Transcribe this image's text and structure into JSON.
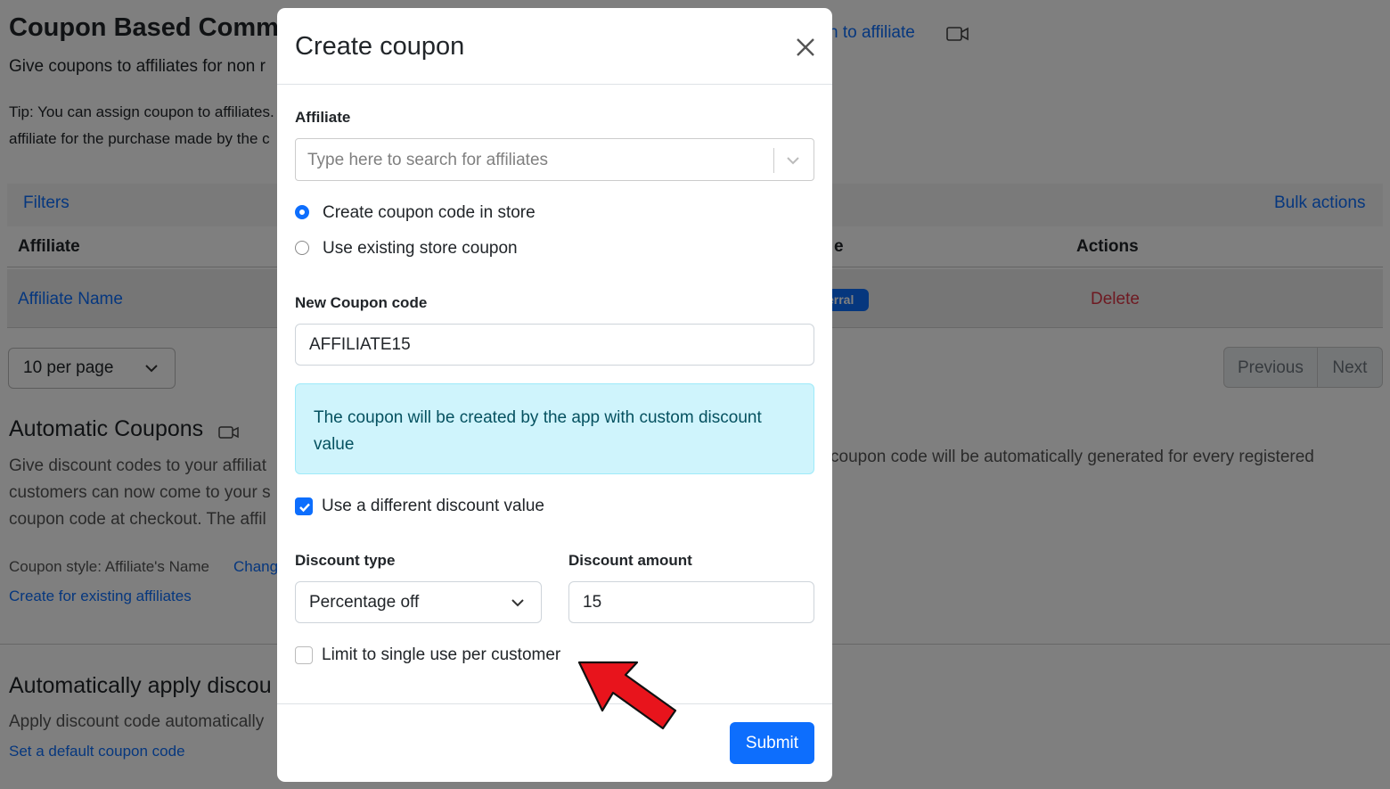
{
  "background": {
    "page_title": "Coupon Based Commi",
    "page_subtitle": "Give coupons to affiliates for non r",
    "assign_link": "n to affiliate",
    "tip_line1": "Tip: You can assign coupon to affiliates.",
    "tip_line2": "affiliate for the purchase made by the c",
    "filters": "Filters",
    "bulk_actions": "Bulk actions",
    "table_headers": {
      "affiliate": "Affiliate",
      "type_partial": "e",
      "actions": "Actions"
    },
    "row": {
      "affiliate_name": "Affiliate Name",
      "badge": "erral",
      "delete": "Delete"
    },
    "per_page": "10 per page",
    "pager": {
      "previous": "Previous",
      "next": "Next"
    },
    "automatic_coupons": {
      "title": "Automatic Coupons",
      "line1": "Give discount codes to your affiliat",
      "line2": "customers can now come to your s",
      "line3": "coupon code at checkout. The affil",
      "right_text": "coupon code will be automatically generated for every registered",
      "coupon_style": "Coupon style: Affiliate's Name",
      "change": "Chang",
      "create_existing": "Create for existing affiliates"
    },
    "auto_apply": {
      "title": "Automatically apply discou",
      "line1": "Apply discount code automatically",
      "set_default": "Set a default coupon code"
    }
  },
  "modal": {
    "title": "Create coupon",
    "affiliate_label": "Affiliate",
    "affiliate_placeholder": "Type here to search for affiliates",
    "radio_create": "Create coupon code in store",
    "radio_existing": "Use existing store coupon",
    "coupon_code_label": "New Coupon code",
    "coupon_code_value": "AFFILIATE15",
    "alert_text": "The coupon will be created by the app with custom discount value",
    "different_discount_label": "Use a different discount value",
    "discount_type_label": "Discount type",
    "discount_type_value": "Percentage off",
    "discount_amount_label": "Discount amount",
    "discount_amount_value": "15",
    "limit_label": "Limit to single use per customer",
    "submit": "Submit"
  },
  "colors": {
    "primary": "#0d6efd",
    "danger": "#dc3545",
    "alert_bg": "#cff4fc",
    "arrow": "#e8141c"
  }
}
